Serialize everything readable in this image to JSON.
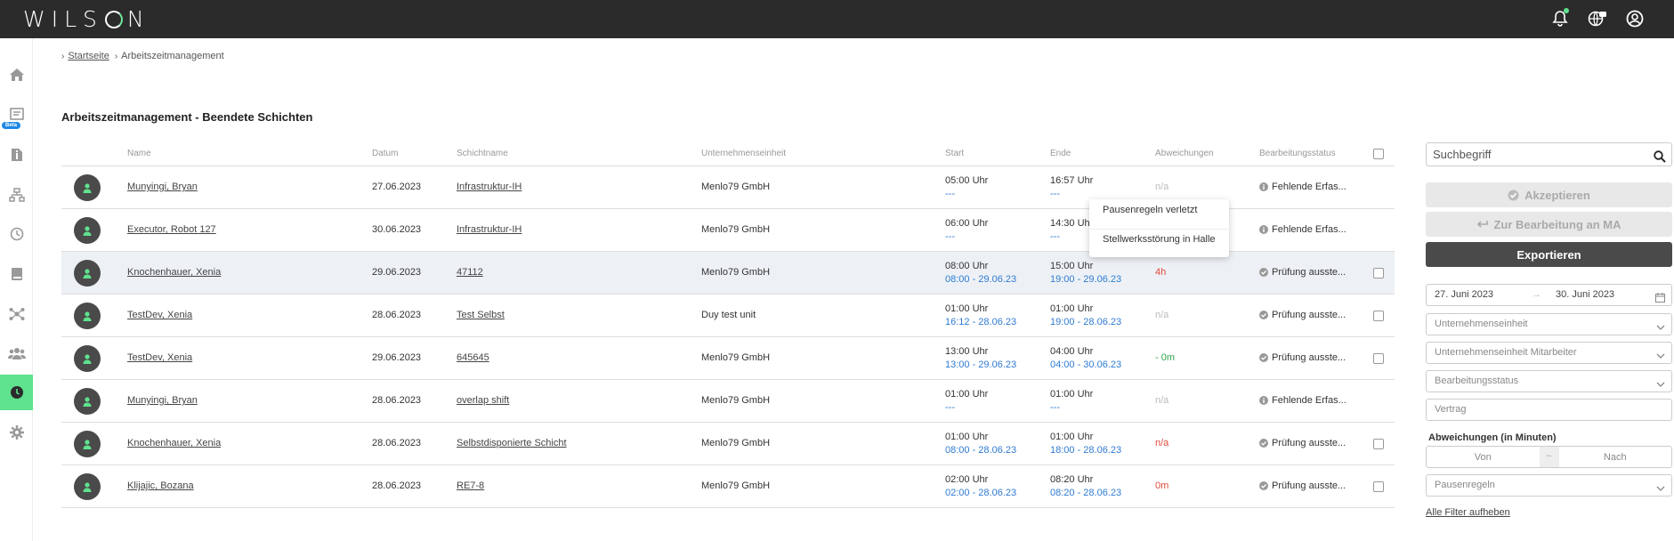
{
  "app": {
    "logo_text": "WILSON",
    "accent": "#5fe28e"
  },
  "topbar": {
    "icons": [
      "bell-icon",
      "globe-chat-icon",
      "user-account-icon"
    ]
  },
  "sidebar": {
    "items": [
      "home-icon",
      "dashboard-icon",
      "info-icon",
      "org-chart-icon",
      "clock-icon",
      "book-icon",
      "network-icon",
      "users-icon",
      "time-management-icon",
      "settings-icon"
    ],
    "beta_label": "Beta"
  },
  "breadcrumb": {
    "home": "Startseite",
    "current": "Arbeitszeitmanagement"
  },
  "page_title": "Arbeitszeitmanagement - Beendete Schichten",
  "table": {
    "headers": {
      "name": "Name",
      "datum": "Datum",
      "schichtname": "Schichtname",
      "unternehmenseinheit": "Unternehmenseinheit",
      "start": "Start",
      "ende": "Ende",
      "abweichungen": "Abweichungen",
      "bearbeitungsstatus": "Bearbeitungsstatus"
    },
    "rows": [
      {
        "name": "Munyingi, Bryan",
        "datum": "27.06.2023",
        "schicht": "Infrastruktur-IH",
        "einheit": "Menlo79 GmbH",
        "start1": "05:00 Uhr",
        "start2": "---",
        "ende1": "16:57 Uhr",
        "ende2": "---",
        "abw": "n/a",
        "status": "Fehlende Erfas...",
        "status_icon": "info",
        "checkbox": false
      },
      {
        "name": "Executor, Robot 127",
        "datum": "30.06.2023",
        "schicht": "Infrastruktur-IH",
        "einheit": "Menlo79 GmbH",
        "start1": "06:00 Uhr",
        "start2": "---",
        "ende1": "14:30 Uhr",
        "ende2": "---",
        "abw": "",
        "status": "Fehlende Erfas...",
        "status_icon": "info",
        "checkbox": false
      },
      {
        "name": "Knochenhauer, Xenia",
        "datum": "29.06.2023",
        "schicht": "47112",
        "einheit": "Menlo79 GmbH",
        "start1": "08:00 Uhr",
        "start2": "08:00 - 29.06.23",
        "ende1": "15:00 Uhr",
        "ende2": "19:00 - 29.06.23",
        "abw": "4h",
        "status": "Prüfung ausste...",
        "status_icon": "check",
        "checkbox": true
      },
      {
        "name": "TestDev, Xenia",
        "datum": "28.06.2023",
        "schicht": "Test Selbst",
        "einheit": "Duy test unit",
        "start1": "01:00 Uhr",
        "start2": "16:12 - 28.06.23",
        "ende1": "01:00 Uhr",
        "ende2": "19:00 - 28.06.23",
        "abw": "n/a",
        "status": "Prüfung ausste...",
        "status_icon": "check",
        "checkbox": true
      },
      {
        "name": "TestDev, Xenia",
        "datum": "29.06.2023",
        "schicht": "645645",
        "einheit": "Menlo79 GmbH",
        "start1": "13:00 Uhr",
        "start2": "13:00 - 29.06.23",
        "ende1": "04:00 Uhr",
        "ende2": "04:00 - 30.06.23",
        "abw": "- 0m",
        "status": "Prüfung ausste...",
        "status_icon": "check",
        "checkbox": true
      },
      {
        "name": "Munyingi, Bryan",
        "datum": "28.06.2023",
        "schicht": "overlap shift",
        "einheit": "Menlo79 GmbH",
        "start1": "01:00 Uhr",
        "start2": "---",
        "ende1": "01:00 Uhr",
        "ende2": "---",
        "abw": "n/a",
        "status": "Fehlende Erfas...",
        "status_icon": "info",
        "checkbox": false
      },
      {
        "name": "Knochenhauer, Xenia",
        "datum": "28.06.2023",
        "schicht": "Selbstdisponierte Schicht",
        "einheit": "Menlo79 GmbH",
        "start1": "01:00 Uhr",
        "start2": "08:00 - 28.06.23",
        "ende1": "01:00 Uhr",
        "ende2": "18:00 - 28.06.23",
        "abw": "n/a",
        "status": "Prüfung ausste...",
        "status_icon": "check",
        "checkbox": true
      },
      {
        "name": "Klijajic, Bozana",
        "datum": "28.06.2023",
        "schicht": "RE7-8",
        "einheit": "Menlo79 GmbH",
        "start1": "02:00 Uhr",
        "start2": "02:00 - 28.06.23",
        "ende1": "08:20 Uhr",
        "ende2": "08:20 - 28.06.23",
        "abw": "0m",
        "status": "Prüfung ausste...",
        "status_icon": "check",
        "checkbox": true
      }
    ]
  },
  "popup": {
    "item1": "Pausenregeln verletzt",
    "item2": "Stellwerksstörung in Halle"
  },
  "filters": {
    "search_placeholder": "Suchbegriff",
    "accept_label": "Akzeptieren",
    "edit_label": "Zur Bearbeitung an MA",
    "export_label": "Exportieren",
    "date_from": "27. Juni 2023",
    "date_to": "30. Juni 2023",
    "unternehmenseinheit": "Unternehmenseinheit",
    "unternehmenseinheit_ma": "Unternehmenseinheit Mitarbeiter",
    "bearbeitungsstatus": "Bearbeitungsstatus",
    "vertrag": "Vertrag",
    "abw_label": "Abweichungen (in Minuten)",
    "von": "Von",
    "nach": "Nach",
    "pausenregeln": "Pausenregeln",
    "all_filters": "Alle Filter aufheben"
  }
}
